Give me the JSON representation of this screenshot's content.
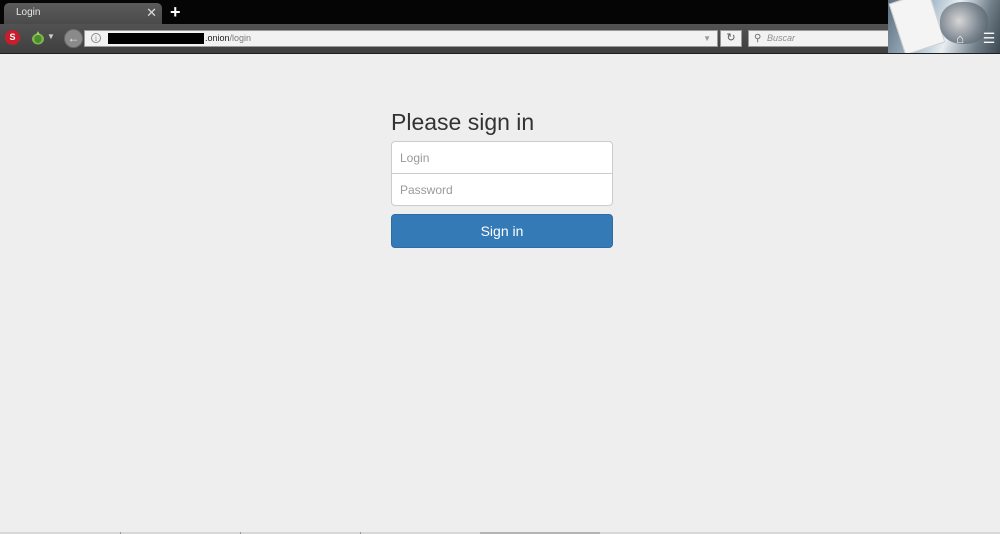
{
  "browser": {
    "tab_title": "Login",
    "tab_close": "✕",
    "new_tab": "+",
    "url_host": ".onion",
    "url_path": "/login",
    "search_placeholder": "Buscar",
    "addon_s_label": "S"
  },
  "page": {
    "heading": "Please sign in",
    "login_placeholder": "Login",
    "password_placeholder": "Password",
    "submit_label": "Sign in"
  },
  "colors": {
    "primary_button": "#337ab7",
    "page_background": "#eeeeee"
  }
}
